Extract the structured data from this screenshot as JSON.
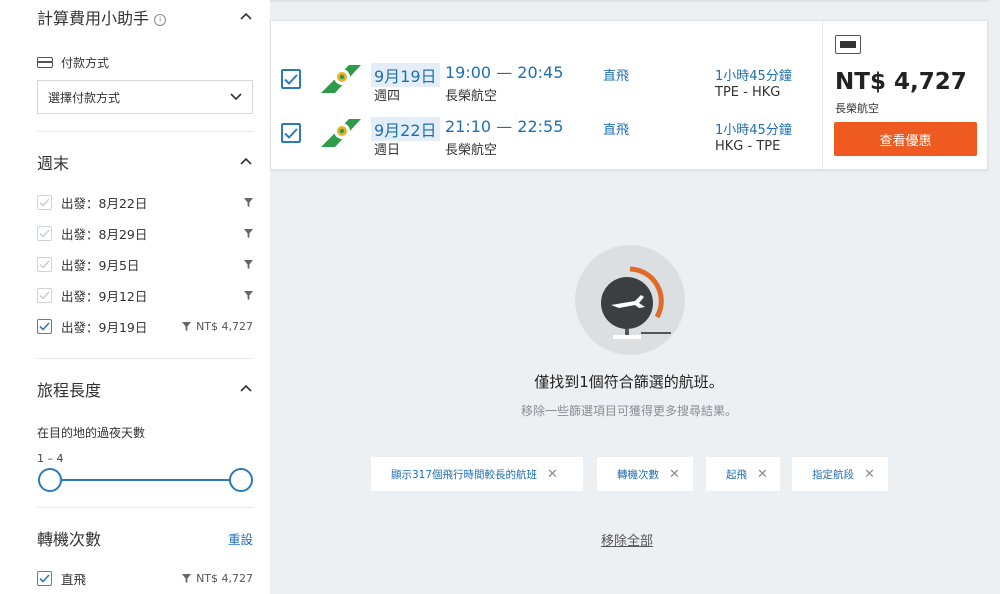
{
  "sidebar": {
    "cost_helper": {
      "title": "計算費用小助手",
      "info_icon": "info-icon"
    },
    "payment": {
      "label": "付款方式",
      "select_value": "選擇付款方式"
    },
    "weekend": {
      "title": "週末",
      "items": [
        {
          "label": "出發：8月22日",
          "checked": false,
          "price": ""
        },
        {
          "label": "出發：8月29日",
          "checked": false,
          "price": ""
        },
        {
          "label": "出發：9月5日",
          "checked": false,
          "price": ""
        },
        {
          "label": "出發：9月12日",
          "checked": false,
          "price": ""
        },
        {
          "label": "出發：9月19日",
          "checked": true,
          "price": "NT$ 4,727"
        }
      ]
    },
    "trip_length": {
      "title": "旅程長度",
      "sub_label": "在目的地的過夜天數",
      "range_text": "1 – 4"
    },
    "stops": {
      "title": "轉機次數",
      "reset": "重設",
      "items": [
        {
          "label": "直飛",
          "checked": true,
          "price": "NT$ 4,727"
        }
      ]
    }
  },
  "result": {
    "legs": [
      {
        "date": "9月19日",
        "dow": "週四",
        "time": "19:00 — 20:45",
        "airline": "長榮航空",
        "stops": "直飛",
        "duration": "1小時45分鐘",
        "route": "TPE ‐ HKG"
      },
      {
        "date": "9月22日",
        "dow": "週日",
        "time": "21:10 — 22:55",
        "airline": "長榮航空",
        "stops": "直飛",
        "duration": "1小時45分鐘",
        "route": "HKG ‐ TPE"
      }
    ],
    "price": "NT$ 4,727",
    "price_airline": "長榮航空",
    "deal_button": "查看優惠"
  },
  "empty_state": {
    "message": "僅找到1個符合篩選的航班。",
    "hint": "移除一些篩選項目可獲得更多搜尋結果。",
    "chips": [
      "顯示317個飛行時間較長的航班",
      "轉機次數",
      "起飛",
      "指定航段"
    ],
    "remove_all": "移除全部"
  },
  "colors": {
    "accent_blue": "#1f6fb2",
    "deal_orange": "#ee5a1f",
    "airline_green": "#2e9b4a"
  }
}
